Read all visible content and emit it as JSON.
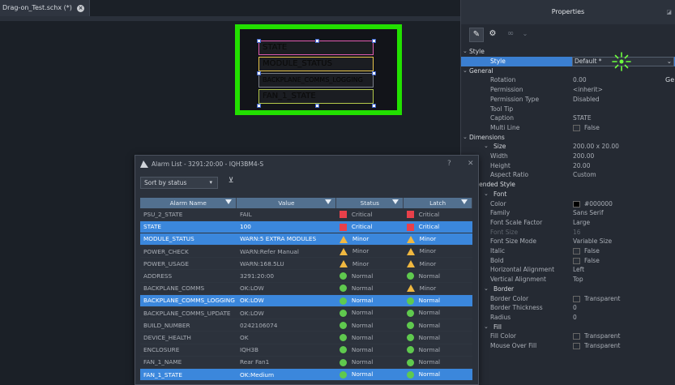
{
  "editor": {
    "tab_label": "Drag-on_Test.schx (*)",
    "canvas_items": [
      "STATE",
      "MODULE_STATUS",
      "BACKPLANE_COMMS_LOGGING",
      "FAN_1_STATE"
    ]
  },
  "properties": {
    "title": "Properties",
    "rows": [
      {
        "type": "section",
        "label": "Style"
      },
      {
        "type": "selected",
        "label": "Style",
        "value": "Default *"
      },
      {
        "type": "section",
        "label": "General"
      },
      {
        "label": "Rotation",
        "value": "0.00"
      },
      {
        "label": "Permission",
        "value": "<inherit>"
      },
      {
        "label": "Permission Type",
        "value": "Disabled"
      },
      {
        "label": "Tool Tip",
        "value": ""
      },
      {
        "label": "Caption",
        "value": "STATE"
      },
      {
        "label": "Multi Line",
        "value": "False"
      },
      {
        "type": "section",
        "label": "Dimensions"
      },
      {
        "type": "subsection",
        "label": "Size",
        "value": "200.00 x 20.00"
      },
      {
        "label": "Width",
        "value": "200.00"
      },
      {
        "label": "Height",
        "value": "20.00"
      },
      {
        "label": "Aspect Ratio",
        "value": "Custom"
      },
      {
        "type": "section",
        "label": "Extended Style"
      },
      {
        "type": "subsection",
        "label": "Font"
      },
      {
        "label": "Color",
        "value": "#000000"
      },
      {
        "label": "Family",
        "value": "Sans Serif"
      },
      {
        "label": "Font Scale Factor",
        "value": "Large"
      },
      {
        "label": "Font Size",
        "value": "16"
      },
      {
        "label": "Font Size Mode",
        "value": "Variable Size"
      },
      {
        "label": "Italic",
        "value": "False"
      },
      {
        "label": "Bold",
        "value": "False"
      },
      {
        "label": "Horizontal Alignment",
        "value": "Left"
      },
      {
        "label": "Vertical Alignment",
        "value": "Top"
      },
      {
        "type": "subsection",
        "label": "Border"
      },
      {
        "label": "Border Color",
        "value": "Transparent"
      },
      {
        "label": "Border Thickness",
        "value": "0"
      },
      {
        "label": "Radius",
        "value": "0"
      },
      {
        "type": "subsection",
        "label": "Fill"
      },
      {
        "label": "Fill Color",
        "value": "Transparent"
      },
      {
        "label": "Mouse Over Fill",
        "value": "Transparent"
      }
    ],
    "general_button": "Ge"
  },
  "alarm_dialog": {
    "title": "Alarm List - 3291:20:00 - IQH3BM4-S",
    "help": "?",
    "close": "✕",
    "sort_label": "Sort by status",
    "columns": [
      "Alarm Name",
      "Value",
      "Status",
      "Latch"
    ],
    "rows": [
      {
        "name": "PSU_2_STATE",
        "value": "FAIL",
        "status": "Critical",
        "latch": "Critical",
        "status_icon": "critical",
        "latch_icon": "critical",
        "selected": false
      },
      {
        "name": "STATE",
        "value": "100",
        "status": "Critical",
        "latch": "Critical",
        "status_icon": "critical",
        "latch_icon": "critical",
        "selected": true
      },
      {
        "name": "MODULE_STATUS",
        "value": "WARN:5 EXTRA MODULES",
        "status": "Minor",
        "latch": "Minor",
        "status_icon": "minor",
        "latch_icon": "minor",
        "selected": true
      },
      {
        "name": "POWER_CHECK",
        "value": "WARN:Refer Manual",
        "status": "Minor",
        "latch": "Minor",
        "status_icon": "minor",
        "latch_icon": "minor",
        "selected": false
      },
      {
        "name": "POWER_USAGE",
        "value": "WARN:168.5LU",
        "status": "Minor",
        "latch": "Minor",
        "status_icon": "minor",
        "latch_icon": "minor",
        "selected": false
      },
      {
        "name": "ADDRESS",
        "value": "3291:20:00",
        "status": "Normal",
        "latch": "Normal",
        "status_icon": "normal",
        "latch_icon": "normal",
        "selected": false
      },
      {
        "name": "BACKPLANE_COMMS",
        "value": "OK:LOW",
        "status": "Normal",
        "latch": "Minor",
        "status_icon": "normal",
        "latch_icon": "minor",
        "selected": false
      },
      {
        "name": "BACKPLANE_COMMS_LOGGING",
        "value": "OK:LOW",
        "status": "Normal",
        "latch": "Normal",
        "status_icon": "normal",
        "latch_icon": "normal",
        "selected": true
      },
      {
        "name": "BACKPLANE_COMMS_UPDATE",
        "value": "OK:LOW",
        "status": "Normal",
        "latch": "Normal",
        "status_icon": "normal",
        "latch_icon": "normal",
        "selected": false
      },
      {
        "name": "BUILD_NUMBER",
        "value": "0242106074",
        "status": "Normal",
        "latch": "Normal",
        "status_icon": "normal",
        "latch_icon": "normal",
        "selected": false
      },
      {
        "name": "DEVICE_HEALTH",
        "value": "OK",
        "status": "Normal",
        "latch": "Normal",
        "status_icon": "normal",
        "latch_icon": "normal",
        "selected": false
      },
      {
        "name": "ENCLOSURE",
        "value": "IQH3B",
        "status": "Normal",
        "latch": "Normal",
        "status_icon": "normal",
        "latch_icon": "normal",
        "selected": false
      },
      {
        "name": "FAN_1_NAME",
        "value": "Rear Fan1",
        "status": "Normal",
        "latch": "Normal",
        "status_icon": "normal",
        "latch_icon": "normal",
        "selected": false
      },
      {
        "name": "FAN_1_STATE",
        "value": "OK:Medium",
        "status": "Normal",
        "latch": "Normal",
        "status_icon": "normal",
        "latch_icon": "normal",
        "selected": true
      }
    ]
  },
  "colors": {
    "selection": "#3b87dc",
    "critical": "#e8404a",
    "minor": "#f0b840",
    "normal": "#5fc94e",
    "highlight_frame": "#22e000"
  }
}
